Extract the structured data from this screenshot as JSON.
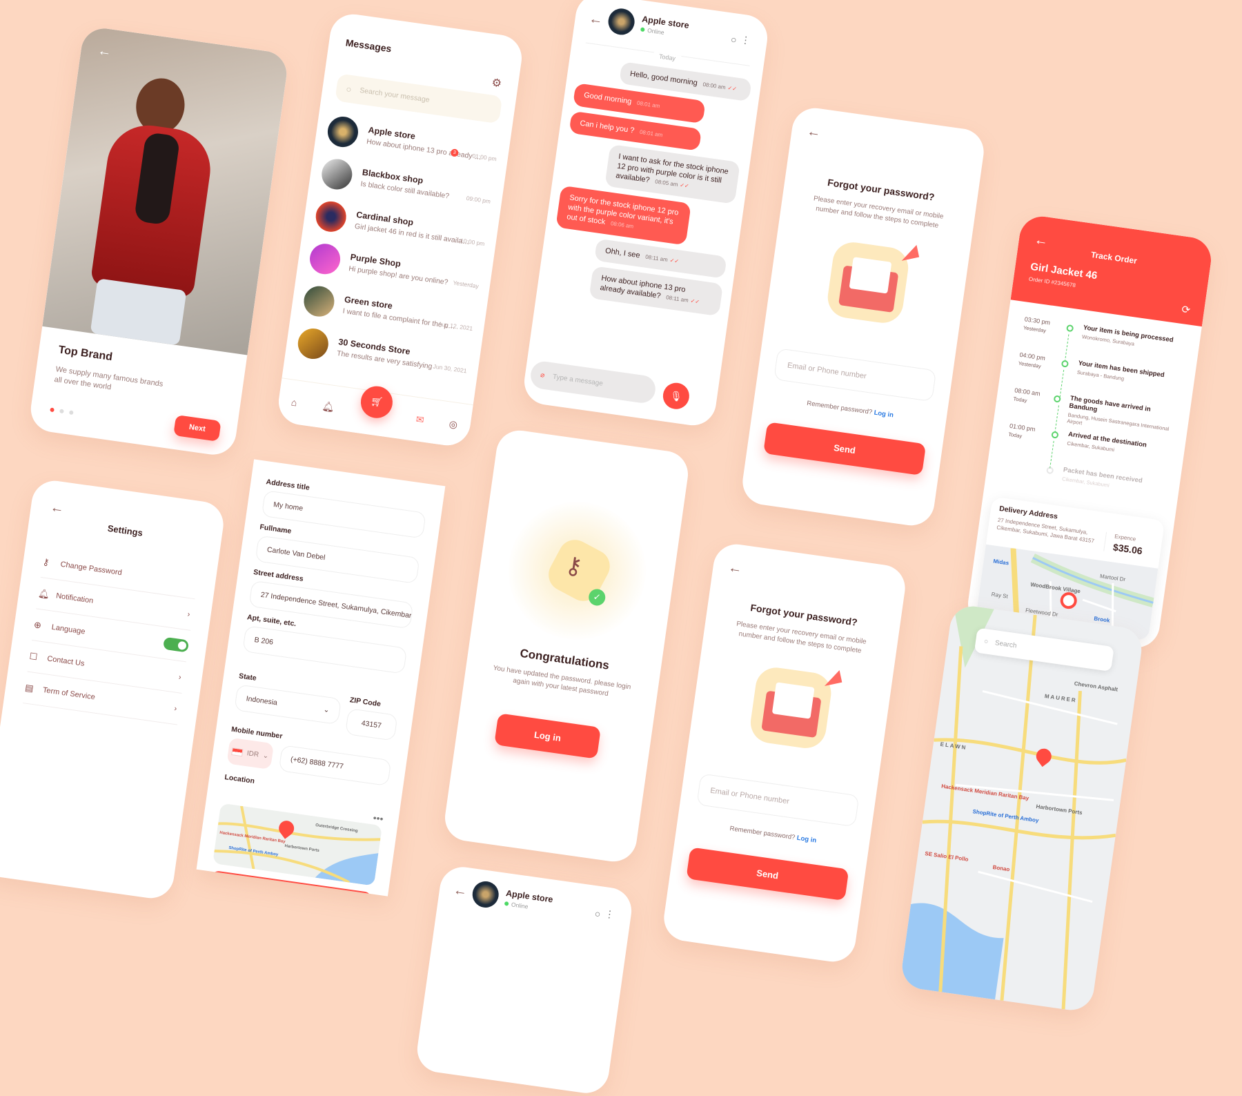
{
  "colors": {
    "background": "#fdd7c1",
    "accent": "#ff4b41",
    "online": "#4cd964",
    "toggle_on": "#4caf50",
    "timeline": "#5bd36c"
  },
  "onboarding": {
    "title": "Top Brand",
    "subtitle": "We supply many famous brands all over the world",
    "next": "Next",
    "current_page": 1,
    "page_count": 3
  },
  "messages": {
    "title": "Messages",
    "search_placeholder": "Search your message",
    "items": [
      {
        "name": "Apple store",
        "preview": "How about iphone 13 pro already avalia....",
        "time": "01:00 pm",
        "unread": "3"
      },
      {
        "name": "Blackbox shop",
        "preview": "Is black color still available?",
        "time": "09:00 pm",
        "unread": ""
      },
      {
        "name": "Cardinal shop",
        "preview": "Girl jacket 46 in red is it still available?",
        "time": "10:00 pm",
        "unread": ""
      },
      {
        "name": "Purple Shop",
        "preview": "Hi purple shop! are you online?",
        "time": "Yesterday",
        "unread": ""
      },
      {
        "name": "Green store",
        "preview": "I want to file a complaint for the purchas....",
        "time": "Aug 12, 2021",
        "unread": ""
      },
      {
        "name": "30 Seconds Store",
        "preview": "The results are very satisfying",
        "time": "Jun 30, 2021",
        "unread": ""
      }
    ]
  },
  "chat": {
    "contact": "Apple store",
    "status": "Online",
    "date_divider": "Today",
    "input_placeholder": "Type a message",
    "messages": [
      {
        "from": "me",
        "text": "Hello, good morning",
        "time": "08:00 am"
      },
      {
        "from": "them",
        "text": "Good morning",
        "time": "08:01 am"
      },
      {
        "from": "them",
        "text": "Can i help you ?",
        "time": "08:01 am"
      },
      {
        "from": "me",
        "text": "I want to ask for the stock iphone 12 pro with purple color is it still available?",
        "time": "08:05 am"
      },
      {
        "from": "them",
        "text": "Sorry for the stock iphone 12 pro with the purple color variant, it's out of stock",
        "time": "08:06 am"
      },
      {
        "from": "me",
        "text": "Ohh, I see",
        "time": "08:11 am"
      },
      {
        "from": "me",
        "text": "How about iphone 13 pro already available?",
        "time": "08:11 am"
      }
    ]
  },
  "forgot": {
    "title": "Forgot your password?",
    "description": "Please enter your recovery email or mobile number and follow the steps to complete",
    "email_placeholder": "Email or Phone number",
    "remember": "Remember password?",
    "login_link": "Log in",
    "send": "Send"
  },
  "track": {
    "title": "Track Order",
    "product": "Girl Jacket 46",
    "order_id": "Order ID #2345678",
    "timeline": [
      {
        "time": "03:30 pm",
        "day": "Yesterday",
        "title": "Your item is being processed",
        "place": "Wonokromo, Surabaya",
        "done": true
      },
      {
        "time": "04:00 pm",
        "day": "Yesterday",
        "title": "Your item has been shipped",
        "place": "Surabaya - Bandung",
        "done": true
      },
      {
        "time": "08:00 am",
        "day": "Today",
        "title": "The goods have arrived in Bandung",
        "place": "Bandung, Husein Sastranegara International Airport",
        "done": true
      },
      {
        "time": "01:00 pm",
        "day": "Today",
        "title": "Arrived at the destination",
        "place": "Cikembar, Sukabumi",
        "done": true
      },
      {
        "time": "",
        "day": "",
        "title": "Packet has been received",
        "place": "Cikembar, Sukabumi",
        "done": false
      }
    ],
    "delivery_title": "Delivery Address",
    "delivery_address": "27 Independence Street, Sukamulya, Cikembar, Sukabumi, Jawa Barat 43157",
    "expense_label": "Expence",
    "expense_value": "$35.06",
    "map_labels": [
      "Midas",
      "WoodBrook Village",
      "Martool Dr",
      "Ray St",
      "Fleetwood Dr",
      "Brook"
    ]
  },
  "settings": {
    "title": "Settings",
    "items": [
      {
        "label": "Change Password",
        "icon": "key-icon",
        "glyph": "⚷",
        "control": "none"
      },
      {
        "label": "Notification",
        "icon": "bell-icon",
        "glyph": "🔔︎",
        "control": "chevron"
      },
      {
        "label": "Language",
        "icon": "globe-icon",
        "glyph": "⊕",
        "control": "toggle"
      },
      {
        "label": "Contact Us",
        "icon": "contact-icon",
        "glyph": "☐",
        "control": "chevron"
      },
      {
        "label": "Term of Service",
        "icon": "document-icon",
        "glyph": "▤",
        "control": "chevron"
      }
    ],
    "notification_toggle_on": true
  },
  "address_form": {
    "fields": [
      {
        "label": "Address title",
        "value": "My home"
      },
      {
        "label": "Fullname",
        "value": "Carlote Van Debel"
      },
      {
        "label": "Street address",
        "value": "27 Independence Street, Sukamulya, Cikembar..."
      },
      {
        "label": "Apt, suite, etc.",
        "value": "B 206"
      }
    ],
    "state_label": "State",
    "state_value": "Indonesia",
    "zip_label": "ZIP Code",
    "zip_value": "43157",
    "mobile_label": "Mobile number",
    "currency": "IDR",
    "phone": "(+62)  8888  7777",
    "location_label": "Location",
    "map_labels": [
      "Hackensack Meridian Raritan Bay",
      "ShopRite of Perth Amboy",
      "Outerbridge Crossing",
      "Harbortown Ports"
    ]
  },
  "congrats": {
    "title": "Congratulations",
    "description": "You have updated the password. please login again with your latest password",
    "login": "Log in"
  },
  "map_screen": {
    "search_placeholder": "Search",
    "labels": [
      "MAURER",
      "Chevron Asphalt",
      "ELAWN",
      "Hackensack Meridian Raritan Bay",
      "ShopRite of Perth Amboy",
      "Harbortown Ports",
      "SE Salio El Pollo",
      "Bonao"
    ]
  },
  "chat_preview": {
    "contact": "Apple store",
    "status": "Online"
  }
}
